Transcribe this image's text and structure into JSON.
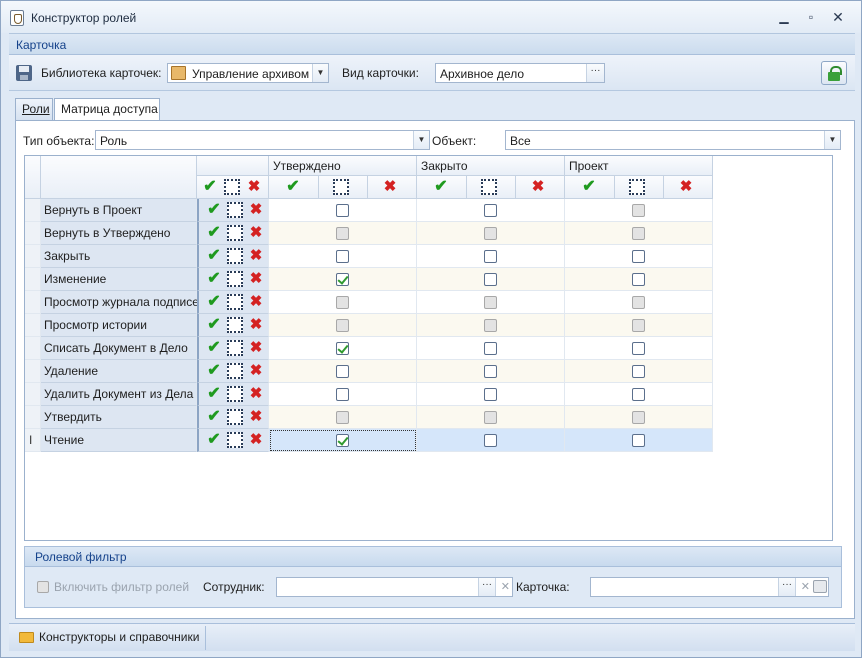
{
  "window": {
    "title": "Конструктор ролей"
  },
  "panel": {
    "title": "Карточка"
  },
  "toolbar": {
    "library_label": "Библиотека карточек:",
    "library_value": "Управление архивом",
    "card_type_label": "Вид карточки:",
    "card_type_value": "Архивное дело"
  },
  "tabs": [
    {
      "label": "Роли"
    },
    {
      "label": "Матрица доступа"
    }
  ],
  "filters": {
    "object_type_label": "Тип объекта:",
    "object_type_value": "Роль",
    "object_label": "Объект:",
    "object_value": "Все"
  },
  "grid": {
    "groups": [
      "Утверждено",
      "Закрыто",
      "Проект"
    ],
    "rows": [
      {
        "name": "Вернуть в Проект",
        "states": [
          "u",
          "u",
          "d"
        ]
      },
      {
        "name": "Вернуть в Утверждено",
        "states": [
          "d",
          "d",
          "d"
        ]
      },
      {
        "name": "Закрыть",
        "states": [
          "u",
          "u",
          "u"
        ]
      },
      {
        "name": "Изменение",
        "states": [
          "c",
          "u",
          "u"
        ]
      },
      {
        "name": "Просмотр журнала подписей",
        "states": [
          "d",
          "d",
          "d"
        ]
      },
      {
        "name": "Просмотр истории",
        "states": [
          "d",
          "d",
          "d"
        ]
      },
      {
        "name": "Списать Документ в Дело",
        "states": [
          "c",
          "u",
          "u"
        ]
      },
      {
        "name": "Удаление",
        "states": [
          "u",
          "u",
          "u"
        ]
      },
      {
        "name": "Удалить Документ из Дела",
        "states": [
          "u",
          "u",
          "u"
        ]
      },
      {
        "name": "Утвердить",
        "states": [
          "d",
          "d",
          "d"
        ]
      },
      {
        "name": "Чтение",
        "states": [
          "c",
          "u",
          "u"
        ]
      }
    ]
  },
  "role_filter": {
    "title": "Ролевой фильтр",
    "enable_label": "Включить фильтр ролей",
    "employee_label": "Сотрудник:",
    "employee_value": "",
    "card_label": "Карточка:",
    "card_value": ""
  },
  "bottom": {
    "button_label": "Конструкторы и справочники"
  },
  "colors": {
    "accent": "#15428b",
    "selected_row": "#d5e6fa",
    "alt_row": "#fbf9f0",
    "check": "#2f9a2f",
    "deny": "#d42222"
  }
}
